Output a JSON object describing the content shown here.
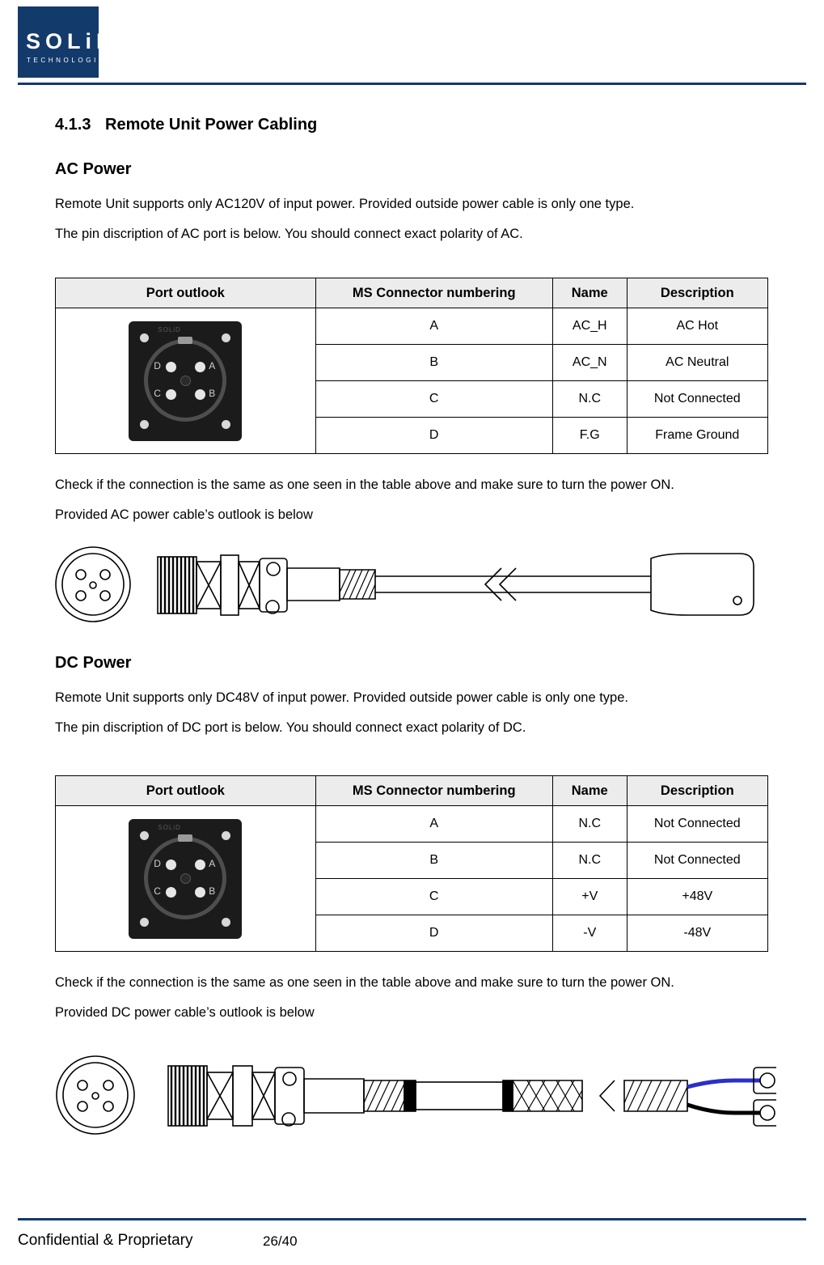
{
  "header": {
    "logo_text": "SOLiD",
    "logo_sub": "TECHNOLOGIES"
  },
  "footer": {
    "left_text": "Confidential & Proprietary",
    "page": "26/40"
  },
  "section": {
    "number": "4.1.3",
    "title": "Remote Unit Power Cabling"
  },
  "ac": {
    "heading": "AC Power",
    "para1": "Remote Unit supports only AC120V of input power. Provided outside power cable is only one type.",
    "para2": "The pin discription of AC port is below. You should connect exact polarity of AC.",
    "note1": "Check if the connection is the same as one seen in the table above and make sure to turn the power ON.",
    "note2": "Provided AC power cable’s outlook is below",
    "table": {
      "headers": [
        "Port outlook",
        "MS Connector numbering",
        "Name",
        "Description"
      ],
      "rows": [
        [
          "A",
          "AC_H",
          "AC Hot"
        ],
        [
          "B",
          "AC_N",
          "AC Neutral"
        ],
        [
          "C",
          "N.C",
          "Not Connected"
        ],
        [
          "D",
          "F.G",
          "Frame Ground"
        ]
      ]
    }
  },
  "dc": {
    "heading": "DC Power",
    "para1": "Remote Unit supports only DC48V of input power. Provided outside power cable is only one type.",
    "para2": "The pin discription of DC port is below. You should connect exact polarity of DC.",
    "note1": "Check if the connection is the same as one seen in the table above and make sure to turn the power ON.",
    "note2": "Provided DC power cable’s outlook is below",
    "table": {
      "headers": [
        "Port outlook",
        "MS Connector numbering",
        "Name",
        "Description"
      ],
      "rows": [
        [
          "A",
          "N.C",
          "Not Connected"
        ],
        [
          "B",
          "N.C",
          "Not Connected"
        ],
        [
          "C",
          "+V",
          "+48V"
        ],
        [
          "D",
          "-V",
          "-48V"
        ]
      ]
    }
  },
  "connector_labels": {
    "a": "A",
    "b": "B",
    "c": "C",
    "d": "D"
  },
  "colors": {
    "brand": "#123a6b",
    "table_header_bg": "#ececec"
  }
}
